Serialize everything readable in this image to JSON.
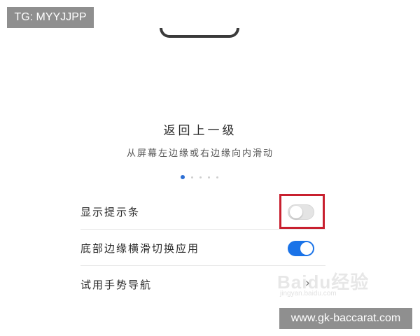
{
  "overlay": {
    "tg_handle": "TG: MYYJJPP",
    "site_url": "www.gk-baccarat.com"
  },
  "gesture_guide": {
    "title": "返回上一级",
    "description": "从屏幕左边缘或右边缘向内滑动",
    "dot_count": 5,
    "active_dot": 1
  },
  "settings": {
    "rows": [
      {
        "label": "显示提示条",
        "control": "toggle",
        "state": "off"
      },
      {
        "label": "底部边缘横滑切换应用",
        "control": "toggle",
        "state": "on"
      },
      {
        "label": "试用手势导航",
        "control": "chevron",
        "icon": "chevron-right-icon"
      }
    ]
  },
  "watermark": {
    "brand": "Baidu经验",
    "sub": "jingyan.baidu.com"
  },
  "colors": {
    "toggle_on": "#1a73e8",
    "toggle_off": "#e4e4e4",
    "highlight": "#c8202f",
    "active_dot": "#2d6fd4",
    "badge_bg": "#8f8f8f"
  }
}
